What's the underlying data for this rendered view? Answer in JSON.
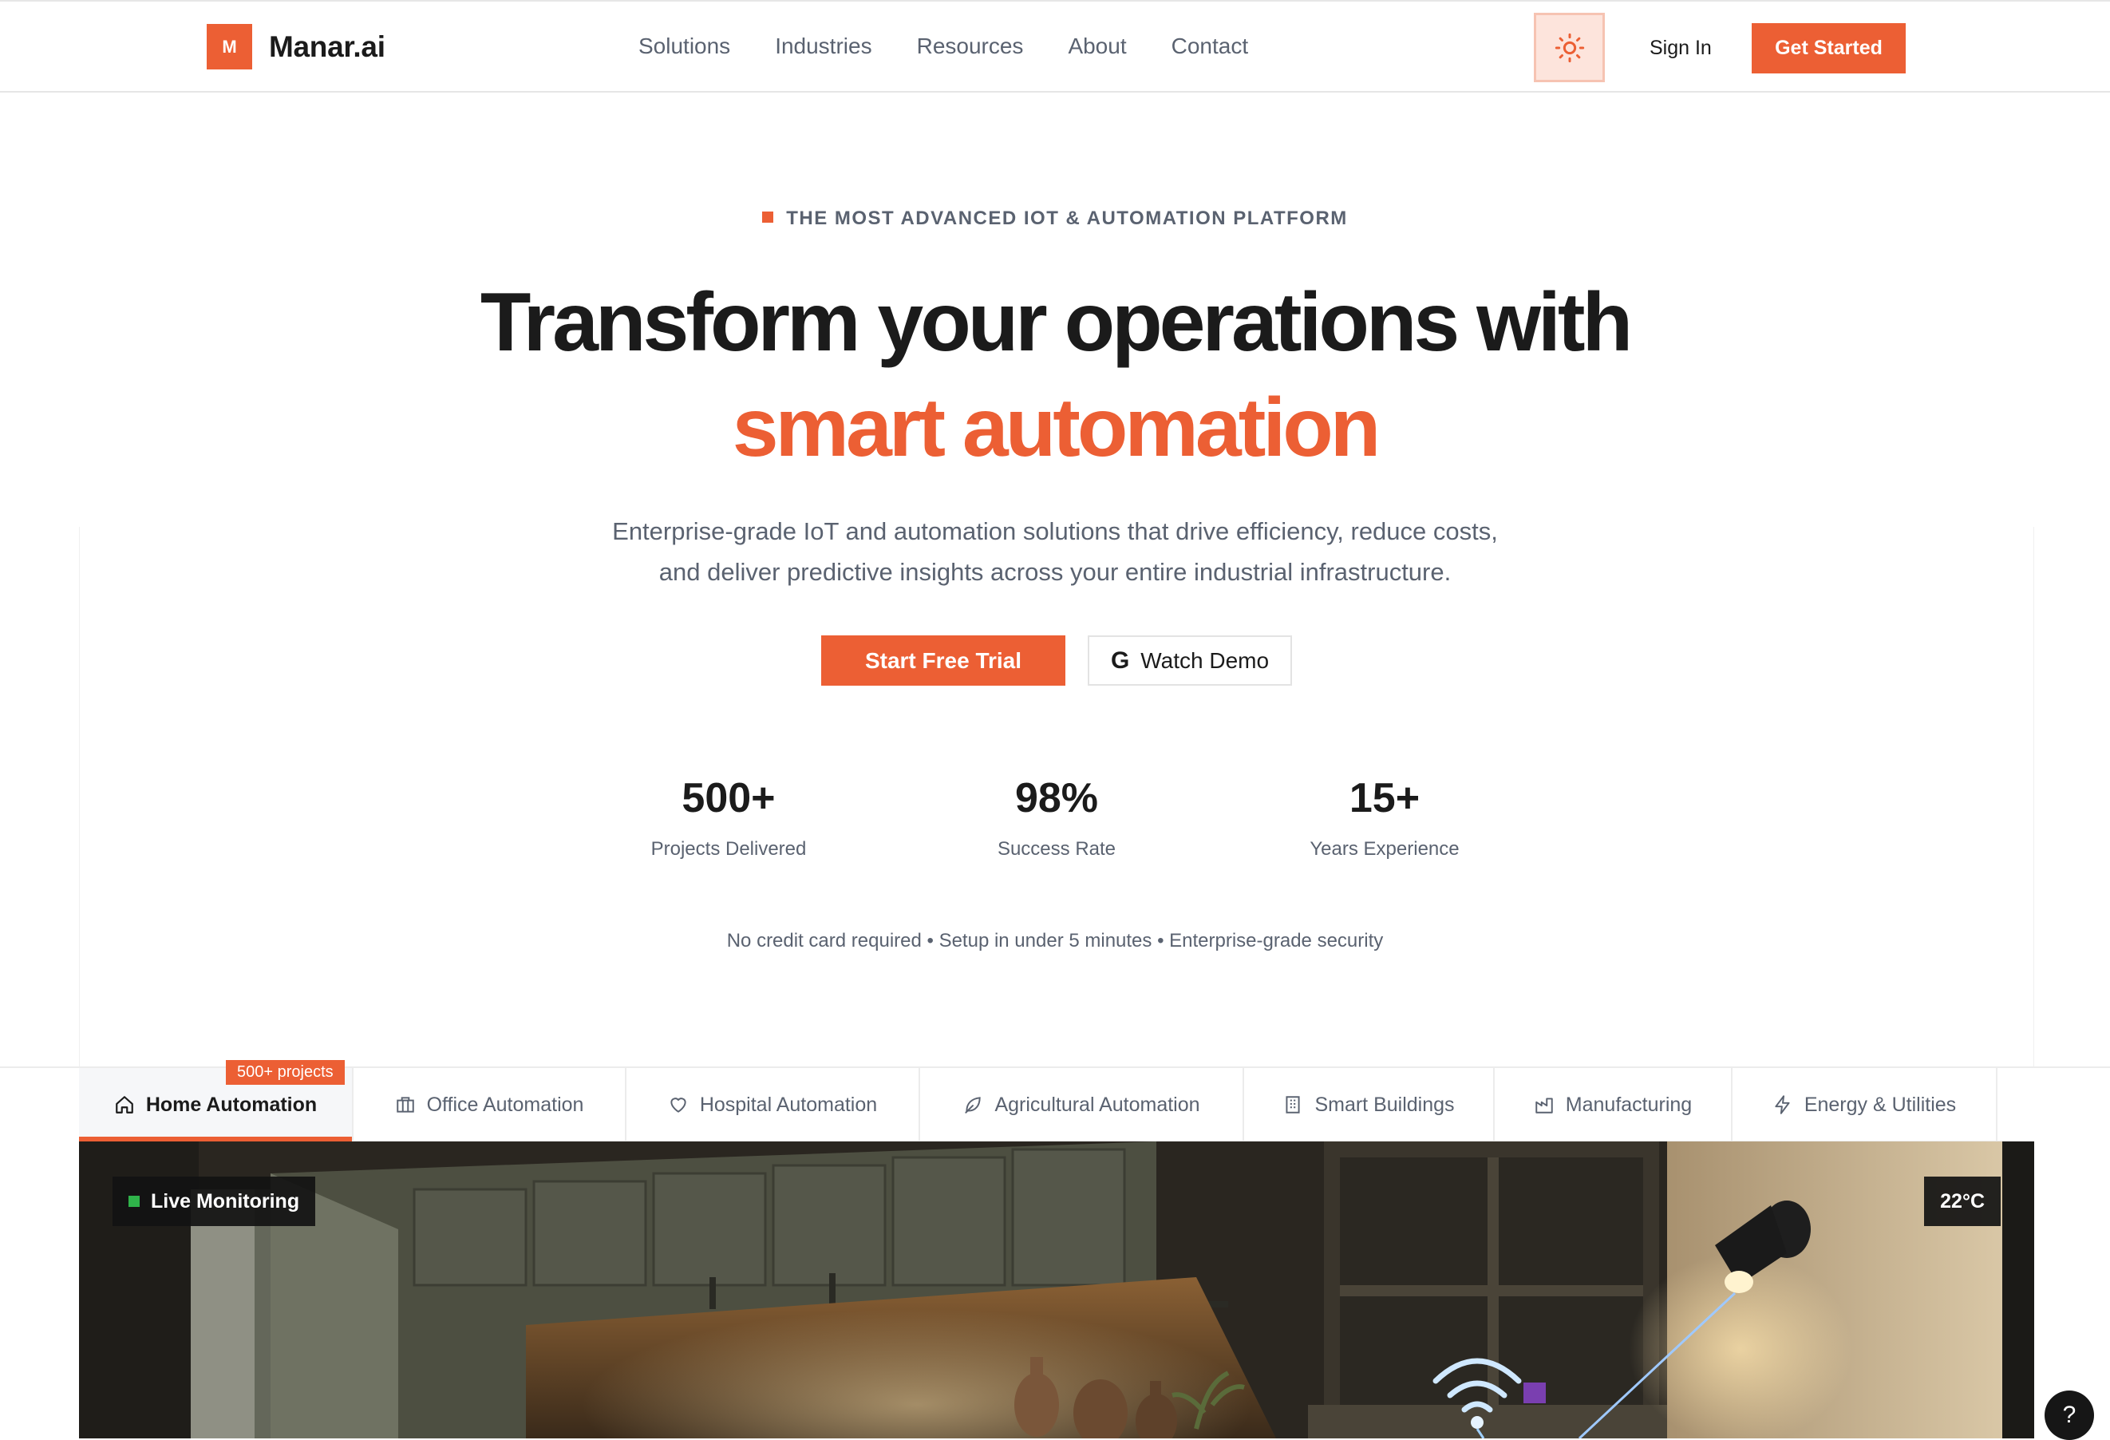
{
  "header": {
    "logo_letter": "M",
    "brand": "Manar.ai",
    "nav": [
      "Solutions",
      "Industries",
      "Resources",
      "About",
      "Contact"
    ],
    "sign_in": "Sign In",
    "get_started": "Get Started"
  },
  "hero": {
    "eyebrow": "THE MOST ADVANCED IOT & AUTOMATION PLATFORM",
    "title_line1": "Transform your operations with",
    "title_line2": "smart automation",
    "subtitle_line1": "Enterprise-grade IoT and automation solutions that drive efficiency, reduce costs,",
    "subtitle_line2": "and deliver predictive insights across your entire industrial infrastructure.",
    "cta_primary": "Start Free Trial",
    "cta_secondary": "Watch Demo",
    "google_glyph": "G",
    "stats": [
      {
        "value": "500+",
        "label": "Projects Delivered"
      },
      {
        "value": "98%",
        "label": "Success Rate"
      },
      {
        "value": "15+",
        "label": "Years Experience"
      }
    ],
    "note": "No credit card required • Setup in under 5 minutes • Enterprise-grade security"
  },
  "tabs": {
    "badge": "500+ projects",
    "items": [
      {
        "label": "Home Automation",
        "icon": "home-icon"
      },
      {
        "label": "Office Automation",
        "icon": "briefcase-icon"
      },
      {
        "label": "Hospital Automation",
        "icon": "heart-icon"
      },
      {
        "label": "Agricultural Automation",
        "icon": "leaf-icon"
      },
      {
        "label": "Smart Buildings",
        "icon": "building-icon"
      },
      {
        "label": "Manufacturing",
        "icon": "factory-icon"
      },
      {
        "label": "Energy & Utilities",
        "icon": "bolt-icon"
      }
    ]
  },
  "scene": {
    "live": "Live Monitoring",
    "temperature": "22°C"
  },
  "help": "?",
  "colors": {
    "accent": "#ec5f34",
    "text": "#1b1b1b",
    "muted": "#5a6270",
    "live": "#2fb34a"
  }
}
